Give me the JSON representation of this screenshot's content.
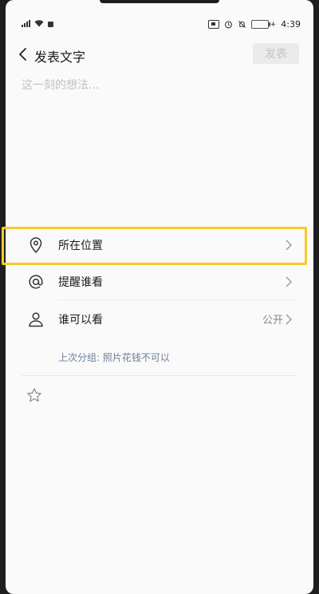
{
  "status_bar": {
    "time": "4:39",
    "charge_symbol": "+",
    "icons": [
      "signal-icon",
      "wifi-icon",
      "notification-icon",
      "nfc-icon",
      "alarm-icon",
      "mute-icon",
      "battery-icon"
    ]
  },
  "header": {
    "title": "发表文字",
    "publish_label": "发表"
  },
  "editor": {
    "placeholder": "这一刻的想法...",
    "value": ""
  },
  "options": {
    "location": {
      "label": "所在位置",
      "icon": "location-pin-icon"
    },
    "remind": {
      "label": "提醒谁看",
      "icon": "at-icon"
    },
    "visibility": {
      "label": "谁可以看",
      "value": "公开",
      "icon": "person-icon"
    },
    "last_group": "上次分组: 照片花钱不可以"
  },
  "colors": {
    "highlight": "#f8c92a",
    "accent_text": "#6b7d96",
    "publish_disabled_bg": "#eceaea"
  }
}
